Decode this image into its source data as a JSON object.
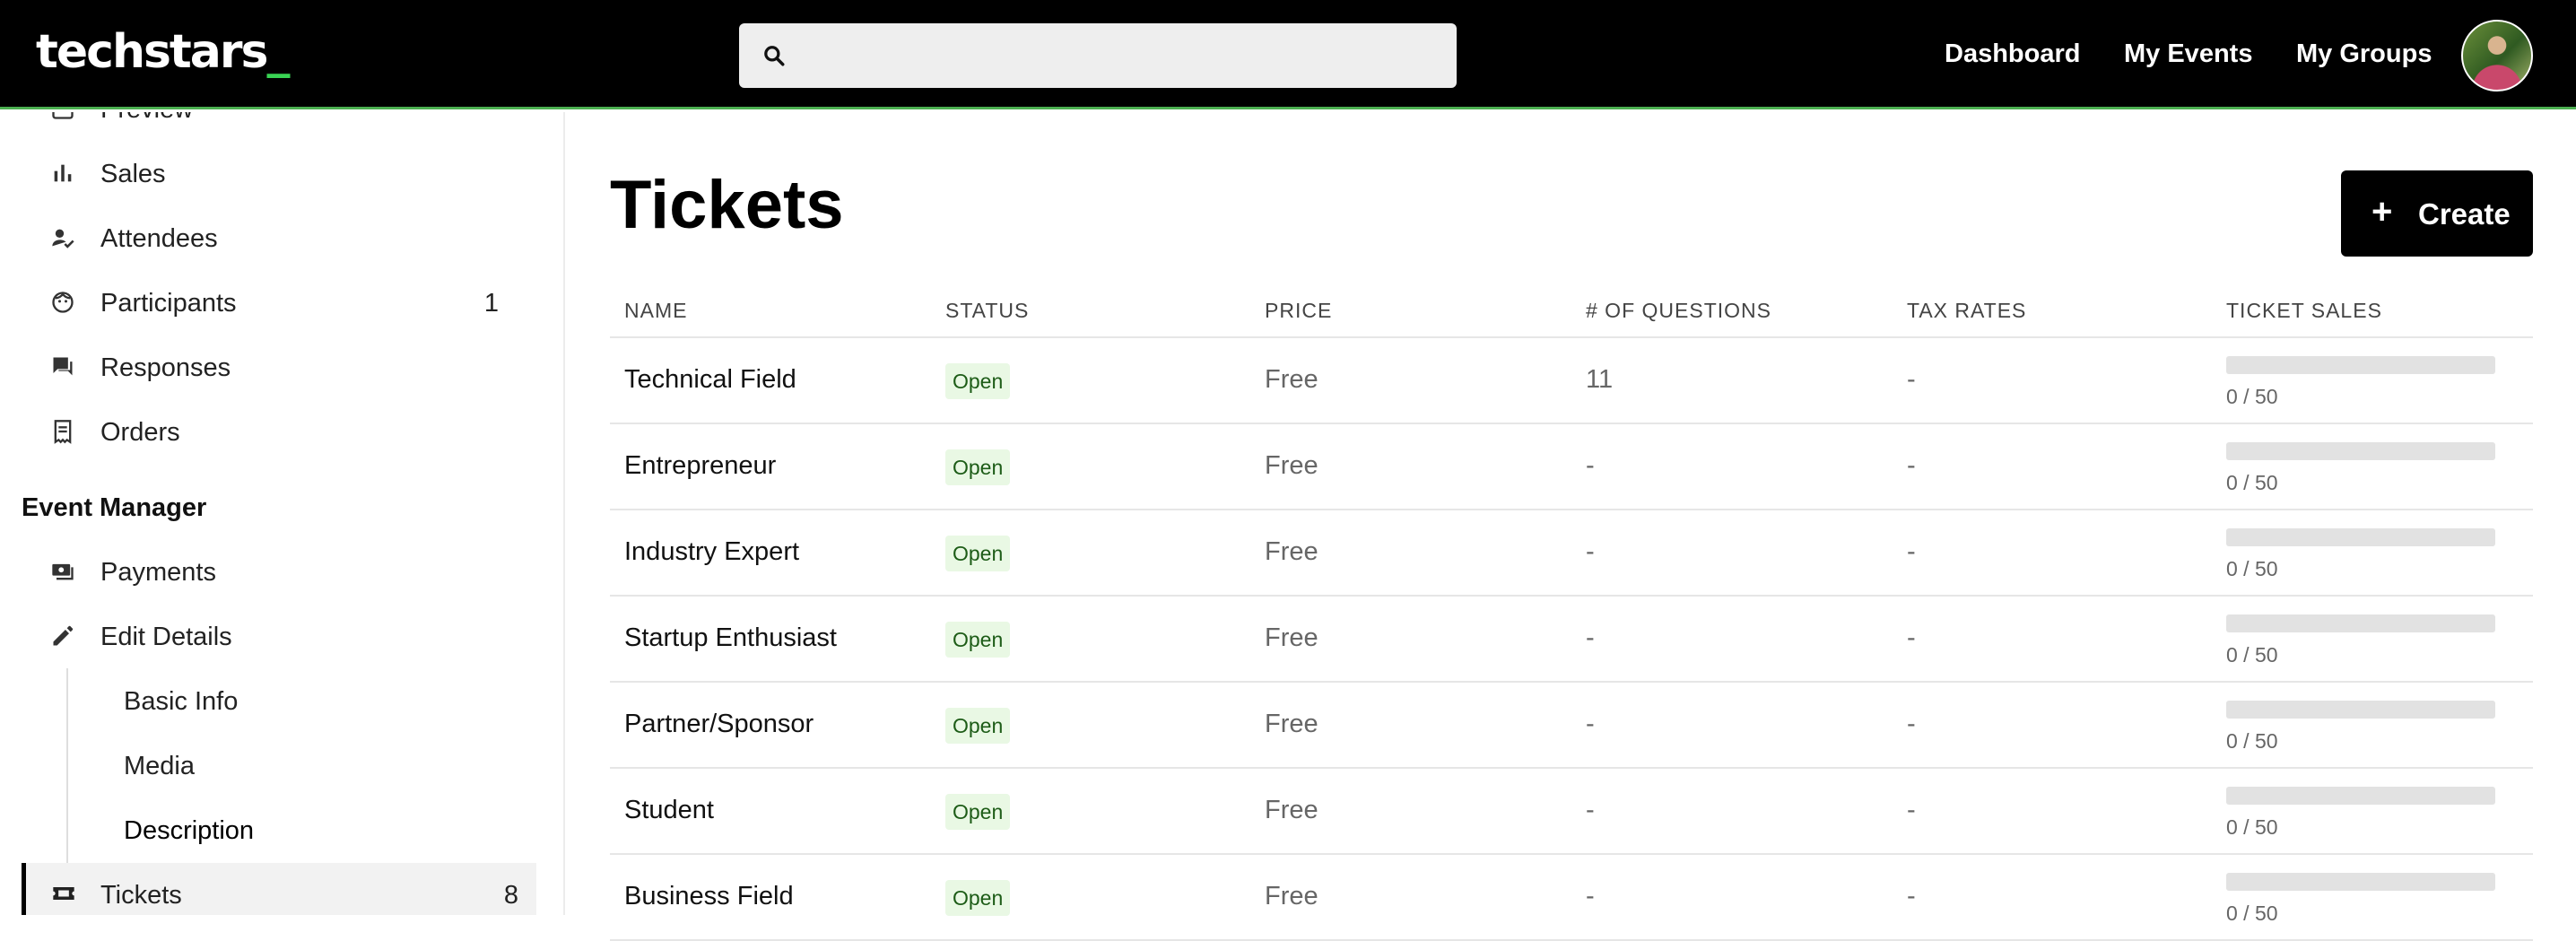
{
  "header": {
    "logo_main": "techstars",
    "logo_suffix": "_",
    "search_placeholder": "",
    "nav": [
      "Dashboard",
      "My Events",
      "My Groups"
    ]
  },
  "sidebar": {
    "top_items": [
      {
        "label": "Preview",
        "icon": "preview-icon",
        "count": ""
      },
      {
        "label": "Sales",
        "icon": "bar-chart-icon",
        "count": ""
      },
      {
        "label": "Attendees",
        "icon": "attendee-check-icon",
        "count": ""
      },
      {
        "label": "Participants",
        "icon": "face-icon",
        "count": "1"
      },
      {
        "label": "Responses",
        "icon": "chat-icon",
        "count": ""
      },
      {
        "label": "Orders",
        "icon": "receipt-icon",
        "count": ""
      }
    ],
    "section_title": "Event Manager",
    "manager_items": [
      {
        "label": "Payments",
        "icon": "payments-icon"
      },
      {
        "label": "Edit Details",
        "icon": "pencil-icon"
      }
    ],
    "sub_items": [
      "Basic Info",
      "Media",
      "Description"
    ],
    "active_item": {
      "label": "Tickets",
      "icon": "ticket-icon",
      "count": "8"
    }
  },
  "main": {
    "title": "Tickets",
    "create_label": "Create",
    "columns": [
      "NAME",
      "STATUS",
      "PRICE",
      "# OF QUESTIONS",
      "TAX RATES",
      "TICKET SALES"
    ],
    "rows": [
      {
        "name": "Technical Field",
        "status": "Open",
        "price": "Free",
        "questions": "11",
        "tax": "-",
        "sales": "0 / 50",
        "progress": 0
      },
      {
        "name": "Entrepreneur",
        "status": "Open",
        "price": "Free",
        "questions": "-",
        "tax": "-",
        "sales": "0 / 50",
        "progress": 0
      },
      {
        "name": "Industry Expert",
        "status": "Open",
        "price": "Free",
        "questions": "-",
        "tax": "-",
        "sales": "0 / 50",
        "progress": 0
      },
      {
        "name": "Startup Enthusiast",
        "status": "Open",
        "price": "Free",
        "questions": "-",
        "tax": "-",
        "sales": "0 / 50",
        "progress": 0
      },
      {
        "name": "Partner/Sponsor",
        "status": "Open",
        "price": "Free",
        "questions": "-",
        "tax": "-",
        "sales": "0 / 50",
        "progress": 0
      },
      {
        "name": "Student",
        "status": "Open",
        "price": "Free",
        "questions": "-",
        "tax": "-",
        "sales": "0 / 50",
        "progress": 0
      },
      {
        "name": "Business Field",
        "status": "Open",
        "price": "Free",
        "questions": "-",
        "tax": "-",
        "sales": "0 / 50",
        "progress": 0
      }
    ]
  },
  "colors": {
    "topbar": "#000000",
    "accent": "#4caf50",
    "status_bg": "#e9f8e4",
    "status_text": "#1d5c17"
  }
}
